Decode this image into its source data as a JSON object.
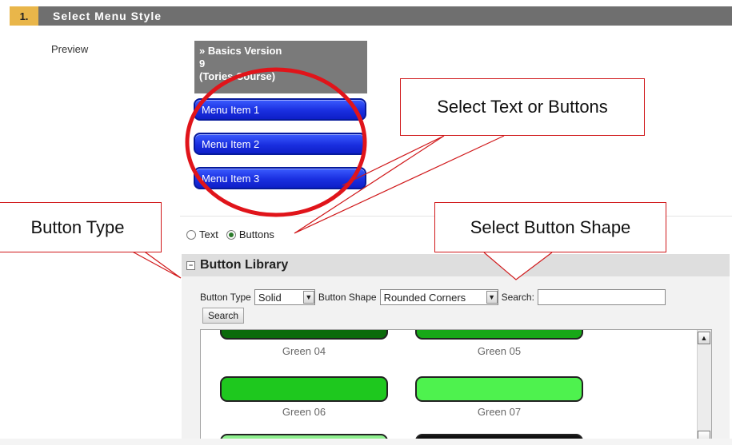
{
  "step": {
    "number": "1.",
    "title": "Select Menu Style"
  },
  "preview": {
    "label": "Preview",
    "header_lines": [
      "» Basics Version",
      "9",
      "(Tories.Course)"
    ],
    "menu_items": [
      "Menu Item 1",
      "Menu Item 2",
      "Menu Item 3"
    ]
  },
  "style_options": {
    "text_label": "Text",
    "buttons_label": "Buttons",
    "selected": "Buttons"
  },
  "library": {
    "title": "Button Library",
    "toggle": "−",
    "button_type_label": "Button Type",
    "button_type_value": "Solid",
    "button_shape_label": "Button Shape",
    "button_shape_value": "Rounded Corners",
    "search_label": "Search:",
    "search_value": "",
    "search_button": "Search",
    "swatches": [
      {
        "label": "Green 04",
        "color": "#0b6b0b"
      },
      {
        "label": "Green 05",
        "color": "#17a817"
      },
      {
        "label": "Green 06",
        "color": "#1ec81e"
      },
      {
        "label": "Green 07",
        "color": "#4ef24e"
      },
      {
        "label": "",
        "color": "#8ef08e"
      },
      {
        "label": "",
        "color": "#111111"
      }
    ]
  },
  "callouts": {
    "text_or_buttons": "Select Text or Buttons",
    "button_type": "Button Type",
    "button_shape": "Select Button Shape"
  },
  "colors": {
    "step_bar": "#6f6f6f",
    "step_num": "#e9b64a",
    "menu_blue": "#1a2fe0",
    "annotation_red": "#d0181a"
  }
}
